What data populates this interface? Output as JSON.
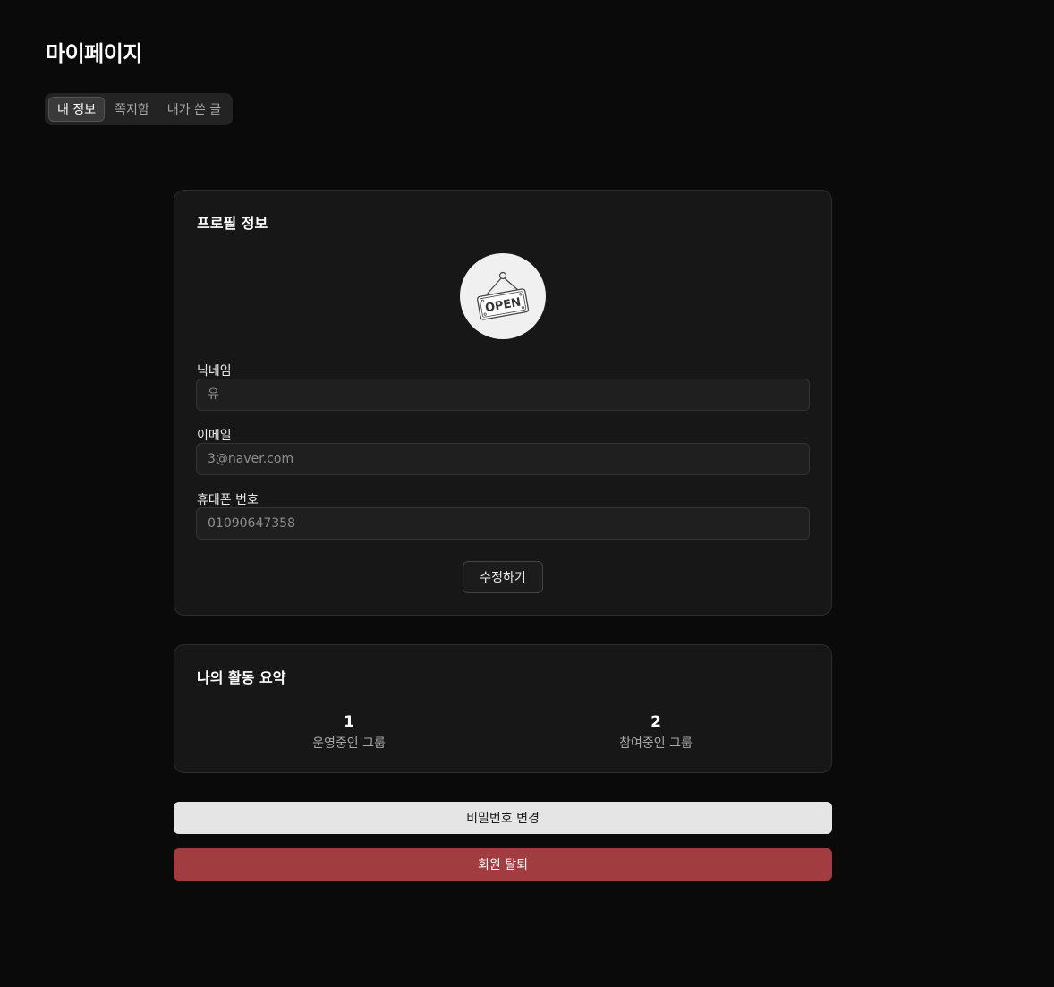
{
  "page": {
    "title": "마이페이지"
  },
  "tabs": [
    {
      "label": "내 정보",
      "active": true
    },
    {
      "label": "쪽지함",
      "active": false
    },
    {
      "label": "내가 쓴 글",
      "active": false
    }
  ],
  "profile": {
    "title": "프로필 정보",
    "avatar_text": "OPEN",
    "fields": {
      "nickname": {
        "label": "닉네임",
        "placeholder": "유"
      },
      "email": {
        "label": "이메일",
        "placeholder": "3@naver.com"
      },
      "phone": {
        "label": "휴대폰 번호",
        "placeholder": "01090647358"
      }
    },
    "edit_label": "수정하기"
  },
  "activity": {
    "title": "나의 활동 요약",
    "stats": [
      {
        "value": "1",
        "label": "운영중인 그룹"
      },
      {
        "value": "2",
        "label": "참여중인 그룹"
      }
    ]
  },
  "actions": {
    "change_password": "비밀번호 변경",
    "withdraw": "회원 탈퇴"
  },
  "colors": {
    "background": "#0a0a0a",
    "card": "#171717",
    "withdraw": "#a13d40",
    "password_button": "#e5e5e5"
  }
}
